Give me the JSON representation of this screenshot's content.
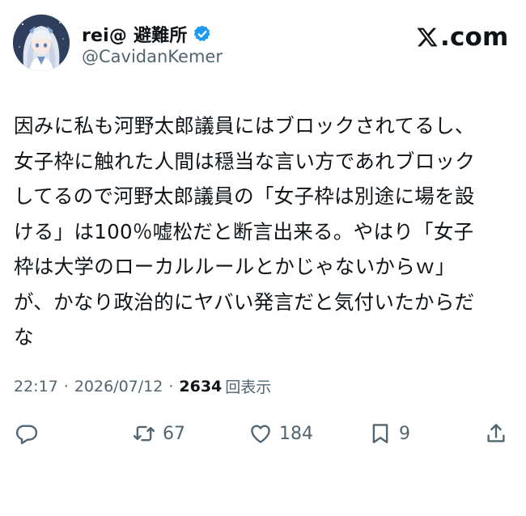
{
  "author": {
    "display_name": "rei@ 避難所",
    "handle": "@CavidanKemer",
    "verified": true
  },
  "brand": {
    "logo_icon": "x-logo-icon",
    "domain_text": ".com"
  },
  "post": {
    "lines": [
      "因みに私も河野太郎議員にはブロックされてるし、",
      "女子枠に触れた人間は穏当な言い方であれブロック",
      "してるので河野太郎議員の「女子枠は別途に場を設",
      "ける」は100％嘘松だと断言出来る。やはり「女子",
      "枠は大学のローカルルールとかじゃないからｗ」",
      "が、かなり政治的にヤバい発言だと気付いたからだ",
      "な"
    ],
    "time": "22:17",
    "date": "2026/07/12",
    "separator": "·",
    "views_count": "2634",
    "views_label": "回表示"
  },
  "actions": {
    "reply": {
      "icon": "reply-icon",
      "count": ""
    },
    "repost": {
      "icon": "repost-icon",
      "count": "67"
    },
    "like": {
      "icon": "heart-icon",
      "count": "184"
    },
    "bookmark": {
      "icon": "bookmark-icon",
      "count": "9"
    },
    "share": {
      "icon": "share-icon",
      "count": ""
    }
  },
  "colors": {
    "text_primary": "#0f1419",
    "text_secondary": "#536471",
    "verified_blue": "#1d9bf0",
    "background": "#ffffff"
  }
}
